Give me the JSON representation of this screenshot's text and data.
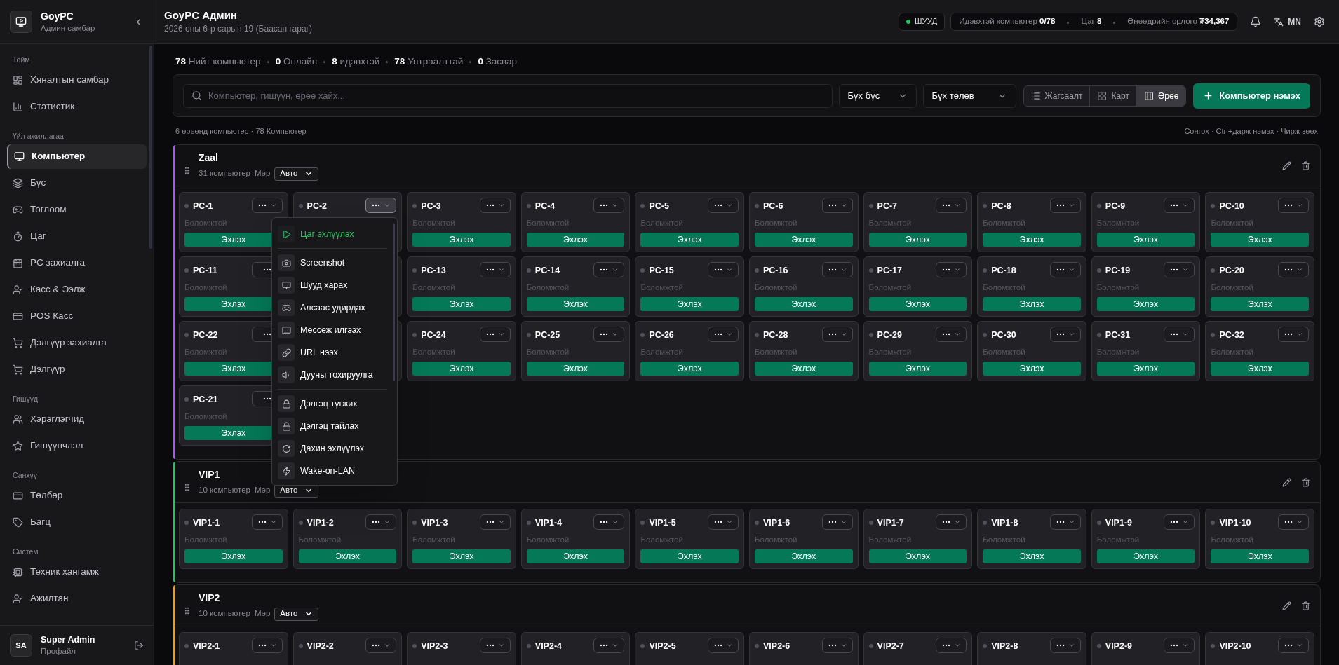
{
  "sidebar": {
    "brand": {
      "title": "GoyPC",
      "subtitle": "Админ самбар"
    },
    "sections": [
      {
        "title": "Тойм",
        "items": [
          {
            "label": "Хяналтын самбар",
            "selected": false
          },
          {
            "label": "Статистик",
            "selected": false
          }
        ]
      },
      {
        "title": "Үйл ажиллагаа",
        "items": [
          {
            "label": "Компьютер",
            "selected": true
          },
          {
            "label": "Бүс",
            "selected": false
          },
          {
            "label": "Тоглоом",
            "selected": false
          },
          {
            "label": "Цаг",
            "selected": false
          },
          {
            "label": "PC захиалга",
            "selected": false
          },
          {
            "label": "Касс & Ээлж",
            "selected": false
          },
          {
            "label": "POS Касс",
            "selected": false
          },
          {
            "label": "Дэлгүүр захиалга",
            "selected": false
          },
          {
            "label": "Дэлгүүр",
            "selected": false
          }
        ]
      },
      {
        "title": "Гишүүд",
        "items": [
          {
            "label": "Хэрэглэгчид",
            "selected": false
          },
          {
            "label": "Гишүүнчлэл",
            "selected": false
          }
        ]
      },
      {
        "title": "Санхүү",
        "items": [
          {
            "label": "Төлбөр",
            "selected": false
          },
          {
            "label": "Багц",
            "selected": false
          }
        ]
      },
      {
        "title": "Систем",
        "items": [
          {
            "label": "Техник хангамж",
            "selected": false
          },
          {
            "label": "Ажилтан",
            "selected": false
          }
        ]
      }
    ],
    "user": {
      "initials": "SA",
      "name": "Super Admin",
      "link": "Профайл"
    }
  },
  "header": {
    "title": "GoyPC Админ",
    "date": "2026 оны 6-р сарын 19 (Баасан гараг)",
    "live": {
      "label": "ШУУД",
      "on": true
    },
    "stats": [
      {
        "label": "Идэвхтэй компьютер",
        "value": "0/78"
      },
      {
        "label": "Цаг",
        "value": "8"
      },
      {
        "label": "Өнөөдрийн орлого",
        "value": "₮34,367"
      }
    ],
    "language": "MN"
  },
  "summary": [
    "**78** Нийт компьютер",
    "**0** Онлайн",
    "**8** идэвхтэй",
    "**78** Унтраалттай",
    "**0** Засвар"
  ],
  "toolbar": {
    "search": {
      "placeholder": "Компьютер, гишүүн, өрөө хайх..."
    },
    "filters": [
      "Бүх бүс",
      "Бүх төлөв"
    ],
    "views": [
      {
        "label": "Жагсаалт",
        "selected": false
      },
      {
        "label": "Карт",
        "selected": false
      },
      {
        "label": "Өрөө",
        "selected": true
      }
    ],
    "add_button": "Компьютер нэмэх"
  },
  "caption": "6 өрөөнд компьютер · 78 Компьютер",
  "hint": "Сонгох · Ctrl+дарж нэмэх · Чирж зөөх",
  "rooms": [
    {
      "name": "Zaal",
      "count": "31 компьютер",
      "row_label": "Мөр",
      "row_mode": "Авто",
      "color": "#a855f7",
      "computers": [
        {
          "kind": "pc",
          "name": "PC-1",
          "status": "Боломжтой",
          "action": "Эхлэх",
          "menu_open": false
        },
        {
          "kind": "pc",
          "name": "PC-2",
          "menu_open": true
        },
        {
          "kind": "pc",
          "name": "PC-3",
          "status": "Боломжтой",
          "action": "Эхлэх",
          "menu_open": false
        },
        {
          "kind": "pc",
          "name": "PC-4",
          "status": "Боломжтой",
          "action": "Эхлэх",
          "menu_open": false
        },
        {
          "kind": "pc",
          "name": "PC-5",
          "status": "Боломжтой",
          "action": "Эхлэх",
          "menu_open": false
        },
        {
          "kind": "pc",
          "name": "PC-6",
          "status": "Боломжтой",
          "action": "Эхлэх",
          "menu_open": false
        },
        {
          "kind": "pc",
          "name": "PC-7",
          "status": "Боломжтой",
          "action": "Эхлэх",
          "menu_open": false
        },
        {
          "kind": "pc",
          "name": "PC-8",
          "status": "Боломжтой",
          "action": "Эхлэх",
          "menu_open": false
        },
        {
          "kind": "pc",
          "name": "PC-9",
          "status": "Боломжтой",
          "action": "Эхлэх",
          "menu_open": false
        },
        {
          "kind": "pc",
          "name": "PC-10",
          "status": "Боломжтой",
          "action": "Эхлэх",
          "menu_open": false
        },
        {
          "kind": "pc",
          "name": "PC-11",
          "status": "Боломжтой",
          "action": "Эхлэх",
          "menu_open": false,
          "chevron_hidden": true
        },
        {
          "kind": "covered"
        },
        {
          "kind": "pc",
          "name": "PC-13",
          "status": "Боломжтой",
          "action": "Эхлэх",
          "menu_open": false
        },
        {
          "kind": "pc",
          "name": "PC-14",
          "status": "Боломжтой",
          "action": "Эхлэх",
          "menu_open": false
        },
        {
          "kind": "pc",
          "name": "PC-15",
          "status": "Боломжтой",
          "action": "Эхлэх",
          "menu_open": false
        },
        {
          "kind": "pc",
          "name": "PC-16",
          "status": "Боломжтой",
          "action": "Эхлэх",
          "menu_open": false
        },
        {
          "kind": "pc",
          "name": "PC-17",
          "status": "Боломжтой",
          "action": "Эхлэх",
          "menu_open": false
        },
        {
          "kind": "pc",
          "name": "PC-18",
          "status": "Боломжтой",
          "action": "Эхлэх",
          "menu_open": false
        },
        {
          "kind": "pc",
          "name": "PC-19",
          "status": "Боломжтой",
          "action": "Эхлэх",
          "menu_open": false
        },
        {
          "kind": "pc",
          "name": "PC-20",
          "status": "Боломжтой",
          "action": "Эхлэх",
          "menu_open": false
        },
        {
          "kind": "pc",
          "name": "PC-22",
          "status": "Боломжтой",
          "action": "Эхлэх",
          "menu_open": false,
          "chevron_hidden": true
        },
        {
          "kind": "covered"
        },
        {
          "kind": "pc",
          "name": "PC-24",
          "status": "Боломжтой",
          "action": "Эхлэх",
          "menu_open": false
        },
        {
          "kind": "pc",
          "name": "PC-25",
          "status": "Боломжтой",
          "action": "Эхлэх",
          "menu_open": false
        },
        {
          "kind": "pc",
          "name": "PC-26",
          "status": "Боломжтой",
          "action": "Эхлэх",
          "menu_open": false
        },
        {
          "kind": "pc",
          "name": "PC-28",
          "status": "Боломжтой",
          "action": "Эхлэх",
          "menu_open": false
        },
        {
          "kind": "pc",
          "name": "PC-29",
          "status": "Боломжтой",
          "action": "Эхлэх",
          "menu_open": false
        },
        {
          "kind": "pc",
          "name": "PC-30",
          "status": "Боломжтой",
          "action": "Эхлэх",
          "menu_open": false
        },
        {
          "kind": "pc",
          "name": "PC-31",
          "status": "Боломжтой",
          "action": "Эхлэх",
          "menu_open": false
        },
        {
          "kind": "pc",
          "name": "PC-32",
          "status": "Боломжтой",
          "action": "Эхлэх",
          "menu_open": false
        },
        {
          "kind": "pc",
          "name": "PC-21",
          "status": "Боломжтой",
          "action": "Эхлэх",
          "menu_open": false,
          "chevron_hidden": true
        }
      ],
      "menu": [
        [
          {
            "kind": "primary",
            "label": "Цаг эхлүүлэх"
          }
        ],
        [
          {
            "kind": "item",
            "label": "Screenshot"
          },
          {
            "kind": "item",
            "label": "Шууд харах"
          },
          {
            "kind": "item",
            "label": "Алсаас удирдах"
          },
          {
            "kind": "item",
            "label": "Мессеж илгээх"
          },
          {
            "kind": "item",
            "label": "URL нээх"
          },
          {
            "kind": "item",
            "label": "Дууны тохируулга"
          }
        ],
        [
          {
            "kind": "item",
            "label": "Дэлгэц түгжих"
          },
          {
            "kind": "item",
            "label": "Дэлгэц тайлах"
          },
          {
            "kind": "item",
            "label": "Дахин эхлүүлэх"
          },
          {
            "kind": "item",
            "label": "Wake-on-LAN"
          }
        ]
      ]
    },
    {
      "name": "VIP1",
      "count": "10 компьютер",
      "row_label": "Мөр",
      "row_mode": "Авто",
      "color": "#22c55e",
      "computers": [
        {
          "kind": "pc",
          "name": "VIP1-1",
          "status": "Боломжтой",
          "action": "Эхлэх",
          "menu_open": false
        },
        {
          "kind": "pc",
          "name": "VIP1-2",
          "status": "Боломжтой",
          "action": "Эхлэх",
          "menu_open": false
        },
        {
          "kind": "pc",
          "name": "VIP1-3",
          "status": "Боломжтой",
          "action": "Эхлэх",
          "menu_open": false
        },
        {
          "kind": "pc",
          "name": "VIP1-4",
          "status": "Боломжтой",
          "action": "Эхлэх",
          "menu_open": false
        },
        {
          "kind": "pc",
          "name": "VIP1-5",
          "status": "Боломжтой",
          "action": "Эхлэх",
          "menu_open": false
        },
        {
          "kind": "pc",
          "name": "VIP1-6",
          "status": "Боломжтой",
          "action": "Эхлэх",
          "menu_open": false
        },
        {
          "kind": "pc",
          "name": "VIP1-7",
          "status": "Боломжтой",
          "action": "Эхлэх",
          "menu_open": false
        },
        {
          "kind": "pc",
          "name": "VIP1-8",
          "status": "Боломжтой",
          "action": "Эхлэх",
          "menu_open": false
        },
        {
          "kind": "pc",
          "name": "VIP1-9",
          "status": "Боломжтой",
          "action": "Эхлэх",
          "menu_open": false
        },
        {
          "kind": "pc",
          "name": "VIP1-10",
          "status": "Боломжтой",
          "action": "Эхлэх",
          "menu_open": false
        }
      ]
    },
    {
      "name": "VIP2",
      "count": "10 компьютер",
      "row_label": "Мөр",
      "row_mode": "Авто",
      "color": "#f59e0b",
      "computers": [
        {
          "kind": "pc",
          "name": "VIP2-1",
          "menu_open": false
        },
        {
          "kind": "pc",
          "name": "VIP2-2",
          "menu_open": false
        },
        {
          "kind": "pc",
          "name": "VIP2-3",
          "menu_open": false
        },
        {
          "kind": "pc",
          "name": "VIP2-4",
          "menu_open": false
        },
        {
          "kind": "pc",
          "name": "VIP2-5",
          "menu_open": false
        },
        {
          "kind": "pc",
          "name": "VIP2-6",
          "menu_open": false
        },
        {
          "kind": "pc",
          "name": "VIP2-7",
          "menu_open": false
        },
        {
          "kind": "pc",
          "name": "VIP2-8",
          "menu_open": false
        },
        {
          "kind": "pc",
          "name": "VIP2-9",
          "menu_open": false
        },
        {
          "kind": "pc",
          "name": "VIP2-10",
          "menu_open": false
        }
      ]
    }
  ]
}
